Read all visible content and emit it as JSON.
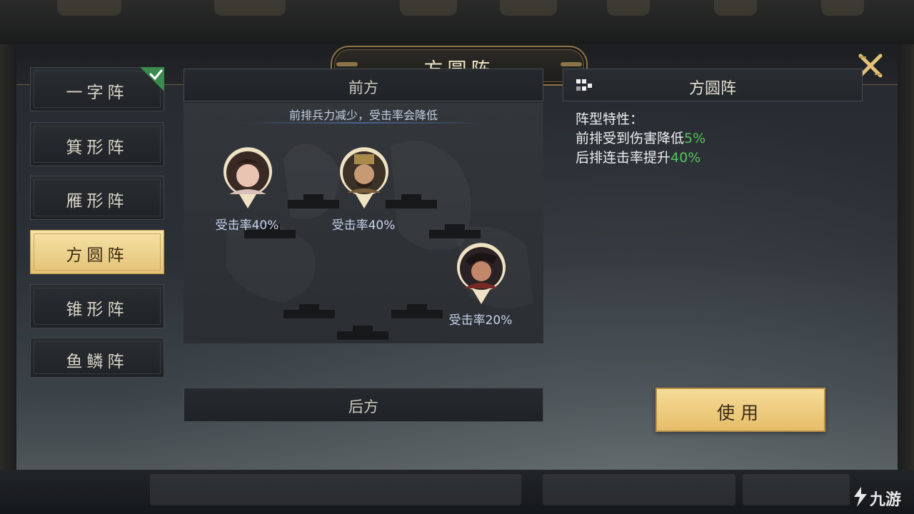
{
  "title": "方圆阵",
  "formations": [
    {
      "label": "一字阵",
      "selected": false,
      "checked": true
    },
    {
      "label": "箕形阵",
      "selected": false,
      "checked": false
    },
    {
      "label": "雁形阵",
      "selected": false,
      "checked": false
    },
    {
      "label": "方圆阵",
      "selected": true,
      "checked": false
    },
    {
      "label": "锥形阵",
      "selected": false,
      "checked": false
    },
    {
      "label": "鱼鳞阵",
      "selected": false,
      "checked": false
    }
  ],
  "field": {
    "front_label": "前方",
    "back_label": "后方",
    "hint": "前排兵力减少，受击率会降低",
    "units": [
      {
        "avatar": "female-hero-portrait",
        "hit_rate": "受击率40%"
      },
      {
        "avatar": "male-hero-portrait",
        "hit_rate": "受击率40%"
      },
      {
        "avatar": "warrior-hero-portrait",
        "hit_rate": "受击率20%"
      }
    ]
  },
  "detail": {
    "name": "方圆阵",
    "traits_title": "阵型特性：",
    "traits": [
      {
        "text": "前排受到伤害降低",
        "value": "5%"
      },
      {
        "text": "后排连击率提升",
        "value": "40%"
      }
    ]
  },
  "use_button": "使用",
  "watermark": "九游",
  "colors": {
    "accent_gold": "#e6bd69",
    "highlight_green": "#54c45b",
    "rate_text": "#c7d3ee"
  }
}
